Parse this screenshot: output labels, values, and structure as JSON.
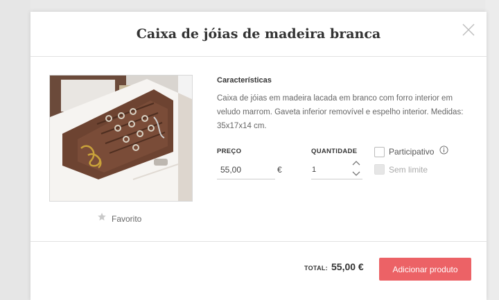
{
  "modal": {
    "title": "Caixa de jóias de madeira branca",
    "close_icon": "close-icon"
  },
  "product": {
    "favorite_label": "Favorito",
    "favorite_icon": "star-icon",
    "characteristics_title": "Características",
    "description": "Caixa de jóias em madeira lacada em branco com forro interior em veludo marrom. Gaveta inferior removível e espelho interior. Medidas: 35x17x14 cm."
  },
  "form": {
    "price_label": "PREÇO",
    "price_value": "55,00",
    "currency": "€",
    "quantity_label": "QUANTIDADE",
    "quantity_value": "1",
    "participative_label": "Participativo",
    "info_icon": "info-icon",
    "unlimited_label": "Sem limite"
  },
  "footer": {
    "total_label": "TOTAL:",
    "total_value": "55,00 €",
    "add_button_label": "Adicionar produto"
  },
  "colors": {
    "accent": "#ec6266",
    "backdrop": "#e9e9e9"
  }
}
